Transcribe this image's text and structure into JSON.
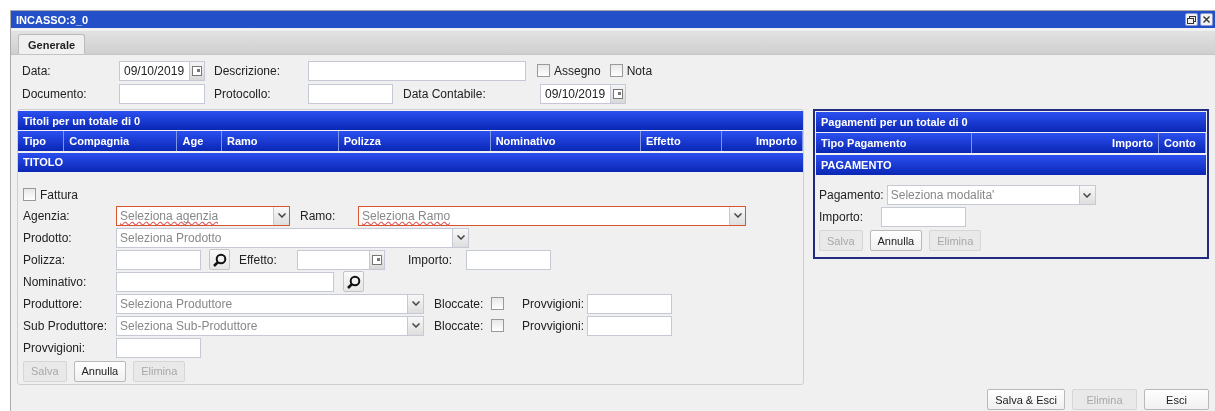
{
  "window": {
    "title": "INCASSO:3_0"
  },
  "tabs": [
    {
      "label": "Generale",
      "selected": true
    }
  ],
  "header": {
    "data": {
      "label": "Data:",
      "value": "09/10/2019"
    },
    "descrizione": {
      "label": "Descrizione:"
    },
    "assegno": {
      "label": "Assegno",
      "checked": false
    },
    "nota": {
      "label": "Nota",
      "checked": false
    },
    "documento": {
      "label": "Documento:"
    },
    "protocollo": {
      "label": "Protocollo:"
    },
    "data_contabile": {
      "label": "Data Contabile:",
      "value": "09/10/2019"
    }
  },
  "titoli": {
    "title": "Titoli per un totale di 0",
    "columns": [
      "Tipo",
      "Compagnia",
      "Age",
      "Ramo",
      "Polizza",
      "Nominativo",
      "Effetto",
      "Importo"
    ]
  },
  "titolo": {
    "title": "TITOLO",
    "fattura": {
      "label": "Fattura",
      "checked": false
    },
    "agenzia": {
      "label": "Agenzia:",
      "placeholder": "Seleziona agenzia",
      "invalid": true
    },
    "ramo": {
      "label": "Ramo:",
      "placeholder": "Seleziona Ramo",
      "invalid": true
    },
    "prodotto": {
      "label": "Prodotto:",
      "placeholder": "Seleziona Prodotto",
      "invalid": false
    },
    "polizza": {
      "label": "Polizza:"
    },
    "effetto": {
      "label": "Effetto:"
    },
    "importo": {
      "label": "Importo:"
    },
    "nominativo": {
      "label": "Nominativo:"
    },
    "produttore": {
      "label": "Produttore:",
      "placeholder": "Seleziona Produttore",
      "invalid": false,
      "bloccate": {
        "label": "Bloccate:",
        "checked": false
      },
      "provvigioni": {
        "label": "Provvigioni:"
      }
    },
    "sub_produttore": {
      "label": "Sub Produttore:",
      "placeholder": "Seleziona Sub-Produttore",
      "invalid": false,
      "bloccate": {
        "label": "Bloccate:",
        "checked": false
      },
      "provvigioni": {
        "label": "Provvigioni:"
      }
    },
    "provvigioni": {
      "label": "Provvigioni:"
    },
    "buttons": [
      {
        "label": "Salva",
        "disabled": true
      },
      {
        "label": "Annulla",
        "disabled": false
      },
      {
        "label": "Elimina",
        "disabled": true
      }
    ]
  },
  "pagamenti": {
    "title": "Pagamenti per un totale di 0",
    "columns": [
      "Tipo Pagamento",
      "Importo",
      "Conto"
    ],
    "form_title": "PAGAMENTO",
    "pagamento": {
      "label": "Pagamento:",
      "placeholder": "Seleziona modalita'",
      "invalid": false
    },
    "importo": {
      "label": "Importo:"
    },
    "buttons": [
      {
        "label": "Salva",
        "disabled": true
      },
      {
        "label": "Annulla",
        "disabled": false
      },
      {
        "label": "Elimina",
        "disabled": true
      }
    ]
  },
  "footer_buttons": [
    {
      "label": "Salva & Esci",
      "disabled": false
    },
    {
      "label": "Elimina",
      "disabled": true
    },
    {
      "label": "Esci",
      "disabled": false
    }
  ]
}
